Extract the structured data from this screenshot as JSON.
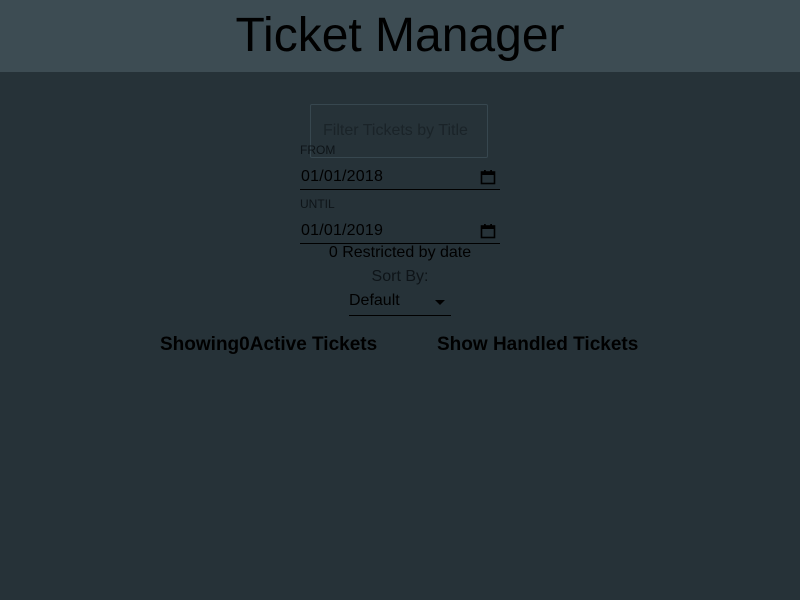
{
  "header": {
    "title": "Ticket Manager"
  },
  "filter": {
    "placeholder": "Filter Tickets by Title"
  },
  "dates": {
    "from_label": "FROM",
    "from_value": "01/01/2018",
    "until_label": "UNTIL",
    "until_value": "01/01/2019"
  },
  "restricted": {
    "count": "0",
    "text": " Restricted by date"
  },
  "sort": {
    "label": "Sort By:",
    "value": "Default"
  },
  "tabs": {
    "active_prefix": "Showing",
    "active_count": "0",
    "active_suffix": "Active Tickets",
    "handled_label": "Show Handled Tickets"
  },
  "icons": {
    "calendar": "calendar-icon",
    "dropdown": "dropdown-arrow-icon"
  }
}
